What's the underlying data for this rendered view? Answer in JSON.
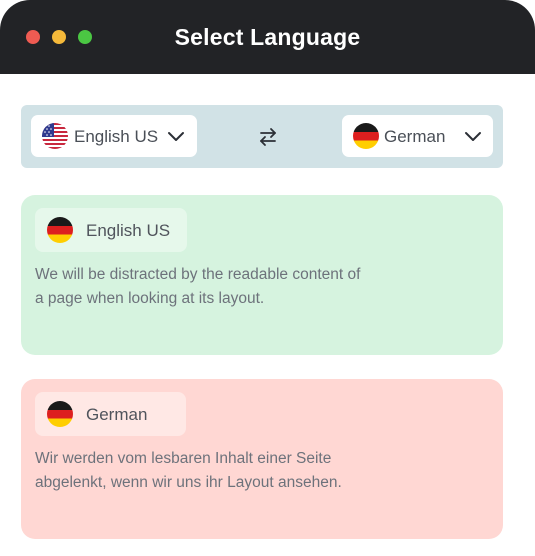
{
  "window": {
    "title": "Select Language",
    "controls": [
      "close",
      "minimize",
      "maximize"
    ]
  },
  "selector": {
    "source": {
      "label": "English US",
      "flag": "us-flag-icon",
      "chevron": "chevron-down-icon"
    },
    "swap_icon": "swap-arrows-icon",
    "target": {
      "label": "German",
      "flag": "germany-flag-icon",
      "chevron": "chevron-down-icon"
    }
  },
  "source_card": {
    "language": "English US",
    "flag": "germany-flag-icon",
    "text_line1": "We will be distracted by the readable content of",
    "text_line2": "a page when looking at its layout.",
    "background": "#d6f3df"
  },
  "target_card": {
    "language": "German",
    "flag": "germany-flag-icon",
    "text_line1": "Wir werden vom lesbaren Inhalt einer Seite",
    "text_line2": "abgelenkt, wenn wir uns ihr Layout ansehen.",
    "background": "#ffd7d3"
  },
  "colors": {
    "titlebar": "#222326",
    "selector_bar": "#d1e2e6",
    "close": "#ef5b52",
    "minimize": "#f5b93a",
    "maximize": "#4bc743"
  }
}
